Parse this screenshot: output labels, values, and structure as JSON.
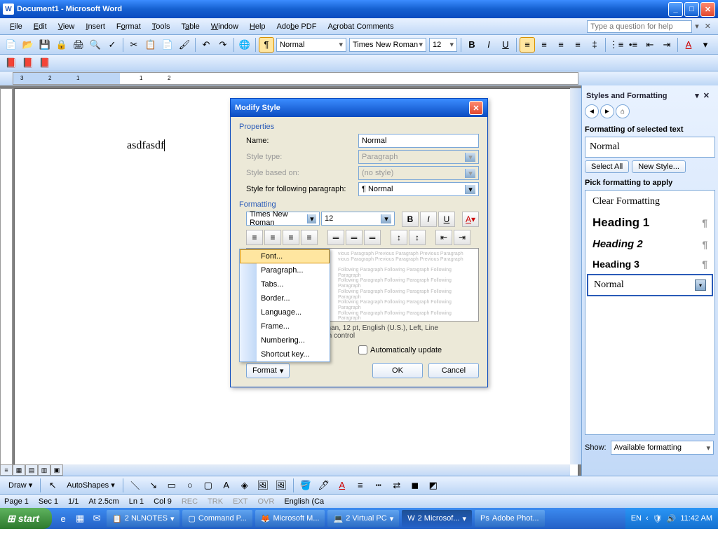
{
  "title": "Document1 - Microsoft Word",
  "menu": [
    "File",
    "Edit",
    "View",
    "Insert",
    "Format",
    "Tools",
    "Table",
    "Window",
    "Help",
    "Adobe PDF",
    "Acrobat Comments"
  ],
  "helpPlaceholder": "Type a question for help",
  "styleBox": "Normal",
  "fontBox": "Times New Roman",
  "sizeBox": "12",
  "docText": "asdfasdf",
  "taskpane": {
    "title": "Styles and Formatting",
    "label1": "Formatting of selected text",
    "current": "Normal",
    "selectAll": "Select All",
    "newStyle": "New Style...",
    "label2": "Pick formatting to apply",
    "items": {
      "clear": "Clear Formatting",
      "h1": "Heading 1",
      "h2": "Heading 2",
      "h3": "Heading 3",
      "normal": "Normal"
    },
    "showLabel": "Show:",
    "showValue": "Available formatting"
  },
  "dialog": {
    "title": "Modify Style",
    "propsLabel": "Properties",
    "nameLabel": "Name:",
    "nameValue": "Normal",
    "typeLabel": "Style type:",
    "typeValue": "Paragraph",
    "basedLabel": "Style based on:",
    "basedValue": "(no style)",
    "followLabel": "Style for following paragraph:",
    "followValue": "¶ Normal",
    "fmtLabel": "Formatting",
    "fmtFont": "Times New Roman",
    "fmtSize": "12",
    "desc": "Roman, 12 pt, English (U.S.), Left, Line",
    "desc2": "phan control",
    "autoUpdate": "Automatically update",
    "formatBtn": "Format",
    "ok": "OK",
    "cancel": "Cancel"
  },
  "popup": [
    "Font...",
    "Paragraph...",
    "Tabs...",
    "Border...",
    "Language...",
    "Frame...",
    "Numbering...",
    "Shortcut key..."
  ],
  "draw": {
    "label": "Draw",
    "autoshapes": "AutoShapes"
  },
  "status": {
    "page": "Page 1",
    "sec": "Sec 1",
    "pages": "1/1",
    "at": "At 2.5cm",
    "ln": "Ln 1",
    "col": "Col 9",
    "rec": "REC",
    "trk": "TRK",
    "ext": "EXT",
    "ovr": "OVR",
    "lang": "English (Ca"
  },
  "taskbar": {
    "start": "start",
    "items": [
      "2 NLNOTES",
      "Command P...",
      "Microsoft M...",
      "2 Virtual PC",
      "2 Microsof...",
      "Adobe Phot..."
    ],
    "lang": "EN",
    "time": "11:42 AM"
  }
}
